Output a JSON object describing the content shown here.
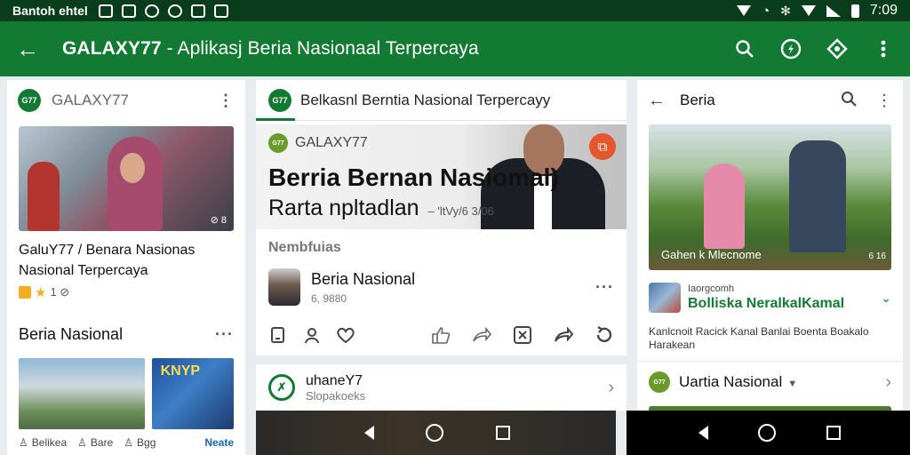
{
  "status_bar": {
    "carrier": "Bantoh ehtel",
    "time": "7:09"
  },
  "app_bar": {
    "title_brand": "GALAXY77",
    "title_rest": " - Aplikasj Beria Nasionaal Terpercaya"
  },
  "left_panel": {
    "header_name": "GALAXY77",
    "hero_count": "⊘ 8",
    "article_title": "GaluY77 / Benara Nasionas Nasional Terpercaya",
    "rating": "1 ⊘",
    "section_title": "Beria Nasional",
    "thumb_text": "KNYP",
    "footer": {
      "a": "Belikea",
      "b": "Bare",
      "c": "Bgg",
      "link": "Neate"
    }
  },
  "middle_panel": {
    "header_title": "Belkasnl Berntia Nasional Terpercayy",
    "hero": {
      "brand": "GALAXY77",
      "headline": "Berria Bernan Nasiomal)",
      "subheadline": "Rarta npltadlan",
      "subheadline_meta": "– 'ltVy/6 3/06"
    },
    "sub_label": "Nembfuias",
    "source": {
      "name": "Beria Nasional",
      "sub": "6, 9880"
    },
    "second_card": {
      "name": "uhaneY7",
      "sub": "Slopakoeks"
    }
  },
  "right_panel": {
    "header_title": "Beria",
    "hero_caption": "Gahen k Mlecnome",
    "hero_count": "6 16",
    "card": {
      "kicker": "Iaorgcomh",
      "headline": "Bolliska NeralkalKamal"
    },
    "description": "Kanlcnoit Racick Kanal Banlai Boenta Boakalo Harakean",
    "row_title": "Uartia Nasional"
  },
  "colors": {
    "app_bar": "#137a33",
    "status_bar": "#0a3d1b",
    "accent_green": "#137a33",
    "link_blue": "#1565c0"
  },
  "icons": {
    "app_bar": [
      "arrow-left-icon",
      "search-icon",
      "compass-icon",
      "share-diamond-icon",
      "more-vert-icon"
    ],
    "middle_actions": [
      "bookmark-icon",
      "person-icon",
      "heart-icon",
      "like-icon",
      "forward-icon",
      "close-box-icon",
      "share-icon",
      "refresh-icon"
    ]
  }
}
